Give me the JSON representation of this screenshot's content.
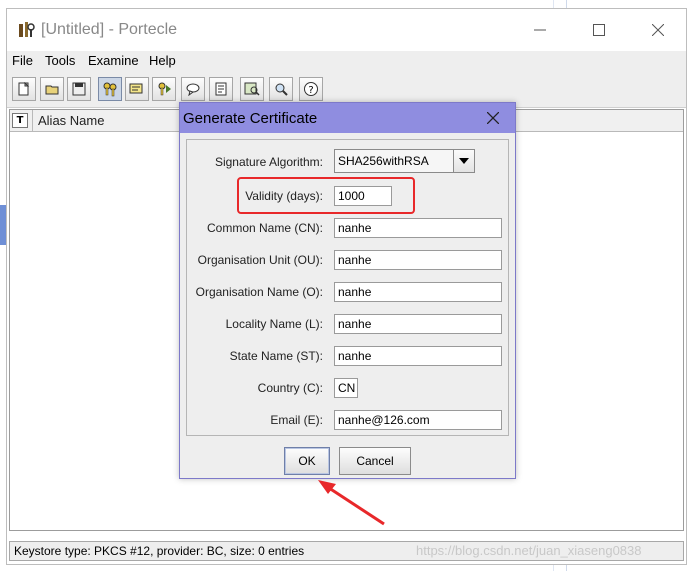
{
  "window": {
    "title": "[Untitled] - Portecle"
  },
  "menu": [
    "File",
    "Tools",
    "Examine",
    "Help"
  ],
  "toolbar_icons": [
    "new-keystore-icon",
    "open-keystore-icon",
    "save-keystore-icon",
    "generate-keypair-icon",
    "import-trusted-cert-icon",
    "import-keypair-icon",
    "keystore-report-icon",
    "change-password-icon",
    "examine-certificate-icon",
    "examine-ssl-icon",
    "help-icon"
  ],
  "table": {
    "type_header": "T",
    "alias_header": "Alias Name"
  },
  "status": "Keystore type: PKCS #12, provider: BC, size: 0 entries",
  "watermark": "https://blog.csdn.net/juan_xiaseng0838",
  "dialog": {
    "title": "Generate Certificate",
    "fields": {
      "signature_algorithm": {
        "label": "Signature Algorithm:",
        "value": "SHA256withRSA"
      },
      "validity": {
        "label": "Validity (days):",
        "value": "1000"
      },
      "cn": {
        "label": "Common Name (CN):",
        "value": "nanhe"
      },
      "ou": {
        "label": "Organisation Unit (OU):",
        "value": "nanhe"
      },
      "o": {
        "label": "Organisation Name (O):",
        "value": "nanhe"
      },
      "l": {
        "label": "Locality Name (L):",
        "value": "nanhe"
      },
      "st": {
        "label": "State Name (ST):",
        "value": "nanhe"
      },
      "c": {
        "label": "Country (C):",
        "value": "CN"
      },
      "e": {
        "label": "Email (E):",
        "value": "nanhe@126.com"
      }
    },
    "ok_label": "OK",
    "cancel_label": "Cancel"
  },
  "annotation_color": "#e8282a"
}
